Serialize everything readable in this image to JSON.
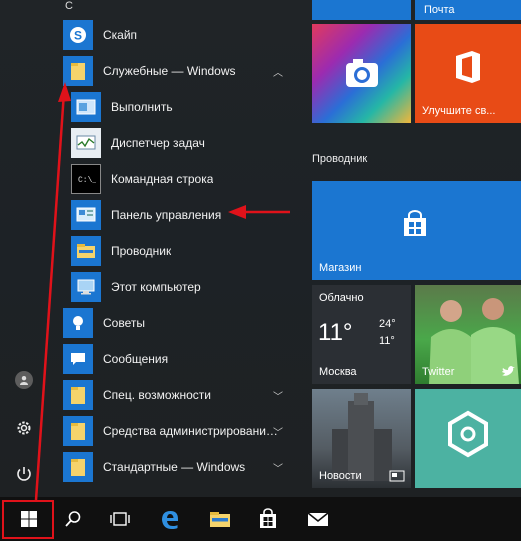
{
  "applist": {
    "section_letter": "С",
    "items": [
      {
        "label": "Скайп",
        "icon": "skype-icon"
      },
      {
        "label": "Служебные — Windows",
        "icon": "folder-icon",
        "expanded": true
      },
      {
        "label": "Выполнить",
        "icon": "run-icon"
      },
      {
        "label": "Диспетчер задач",
        "icon": "task-manager-icon"
      },
      {
        "label": "Командная строка",
        "icon": "cmd-icon"
      },
      {
        "label": "Панель управления",
        "icon": "control-panel-icon"
      },
      {
        "label": "Проводник",
        "icon": "explorer-icon"
      },
      {
        "label": "Этот компьютер",
        "icon": "computer-icon"
      },
      {
        "label": "Советы",
        "icon": "tips-icon"
      },
      {
        "label": "Сообщения",
        "icon": "messaging-icon"
      },
      {
        "label": "Спец. возможности",
        "icon": "folder-icon"
      },
      {
        "label": "Средства администрировани…",
        "icon": "folder-icon"
      },
      {
        "label": "Стандартные — Windows",
        "icon": "folder-icon"
      }
    ]
  },
  "tiles": {
    "mail": {
      "label": "Почта"
    },
    "office": {
      "label": "Улучшите св..."
    },
    "group_header": "Проводник",
    "store": {
      "label": "Магазин"
    },
    "weather": {
      "condition": "Облачно",
      "temp": "11°",
      "high": "24°",
      "low": "11°",
      "city": "Москва"
    },
    "twitter": {
      "label": "Twitter"
    },
    "news": {
      "label": "Новости"
    }
  },
  "taskbar": {
    "items": [
      "start-button",
      "search-icon",
      "task-view-icon",
      "edge-icon",
      "explorer-icon",
      "store-icon",
      "mail-icon"
    ]
  },
  "colors": {
    "accent": "#1b76d1",
    "annotation": "#e0121a"
  }
}
